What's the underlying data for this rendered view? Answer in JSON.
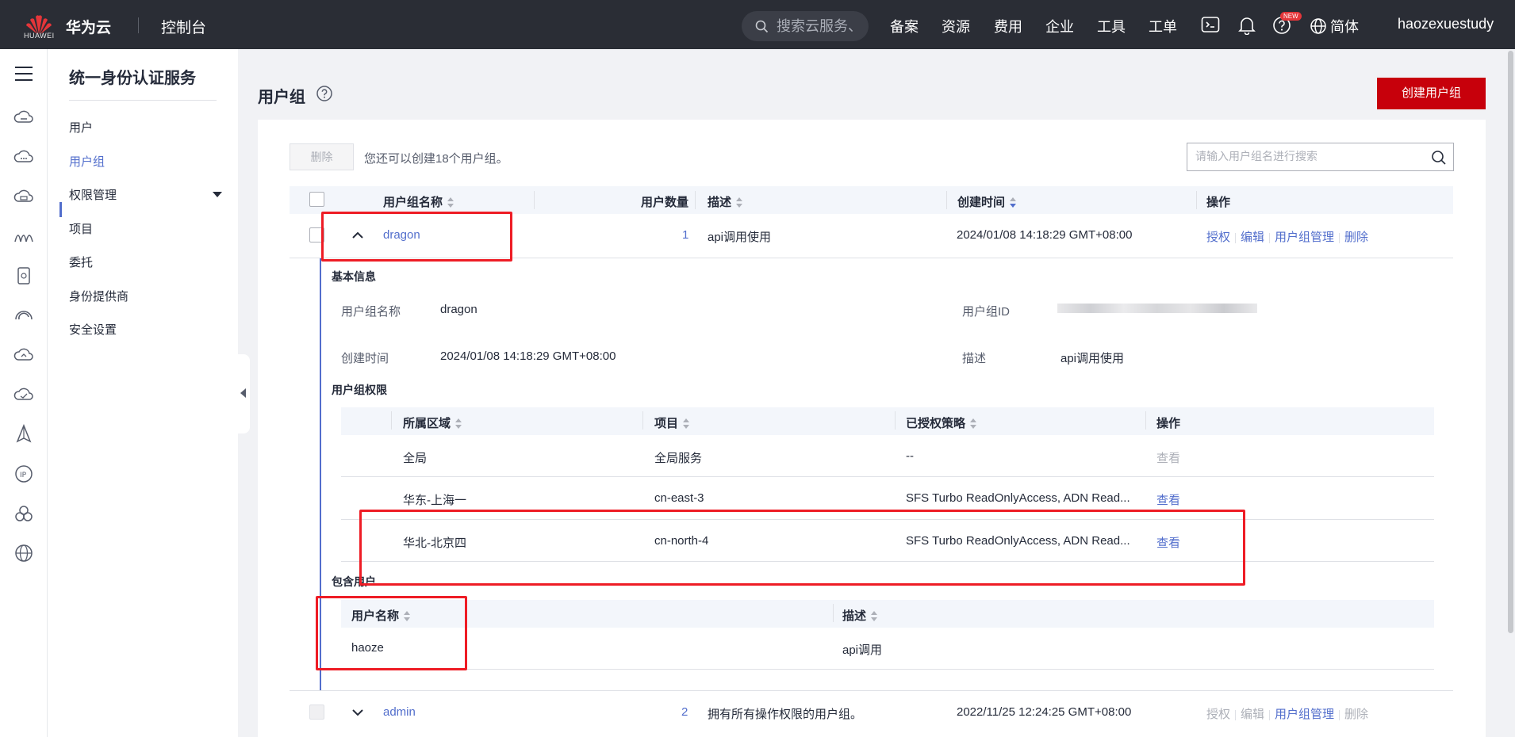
{
  "topbar": {
    "logo_text": "HUAWEI",
    "brand": "华为云",
    "console": "控制台",
    "search_placeholder": "搜索云服务、",
    "nav": [
      "备案",
      "资源",
      "费用",
      "企业",
      "工具",
      "工单"
    ],
    "new_badge": "NEW",
    "lang": "简体",
    "user": "haozexuestudy"
  },
  "rail_icons": [
    "cloud-server-icon",
    "cloud-icon",
    "storage-icon",
    "analytics-icon",
    "container-icon",
    "network-icon",
    "upload-cloud-icon",
    "monitor-cloud-icon",
    "ai-icon",
    "ip-icon",
    "cluster-icon",
    "global-icon"
  ],
  "sidemenu": {
    "title": "统一身份认证服务",
    "items": [
      "用户",
      "用户组",
      "权限管理",
      "项目",
      "委托",
      "身份提供商",
      "安全设置"
    ]
  },
  "page": {
    "title": "用户组",
    "create_button": "创建用户组",
    "delete_button": "删除",
    "quota_text": "您还可以创建18个用户组。",
    "search_placeholder": "请输入用户组名进行搜索"
  },
  "table": {
    "columns": [
      "用户组名称",
      "用户数量",
      "描述",
      "创建时间",
      "操作"
    ],
    "rows": [
      {
        "name": "dragon",
        "count": "1",
        "desc": "api调用使用",
        "created": "2024/01/08 14:18:29 GMT+08:00",
        "ops": [
          "授权",
          "编辑",
          "用户组管理",
          "删除"
        ]
      },
      {
        "name": "admin",
        "count": "2",
        "desc": "拥有所有操作权限的用户组。",
        "created": "2022/11/25 12:24:25 GMT+08:00",
        "ops": [
          "授权",
          "编辑",
          "用户组管理",
          "删除"
        ]
      }
    ]
  },
  "detail": {
    "basic_title": "基本信息",
    "name_label": "用户组名称",
    "name_value": "dragon",
    "id_label": "用户组ID",
    "created_label": "创建时间",
    "created_value": "2024/01/08 14:18:29 GMT+08:00",
    "desc_label": "描述",
    "desc_value": "api调用使用",
    "perm_title": "用户组权限",
    "perm_columns": [
      "所属区域",
      "项目",
      "已授权策略",
      "操作"
    ],
    "perm_rows": [
      {
        "region": "全局",
        "project": "全局服务",
        "policy": "--",
        "op": "查看"
      },
      {
        "region": "华东-上海一",
        "project": "cn-east-3",
        "policy": "SFS Turbo ReadOnlyAccess, ADN Read...",
        "op": "查看"
      },
      {
        "region": "华北-北京四",
        "project": "cn-north-4",
        "policy": "SFS Turbo ReadOnlyAccess, ADN Read...",
        "op": "查看"
      }
    ],
    "users_title": "包含用户",
    "user_columns": [
      "用户名称",
      "描述"
    ],
    "user_rows": [
      {
        "name": "haoze",
        "desc": "api调用"
      }
    ]
  },
  "colors": {
    "topbar": "#2a2d35",
    "brand_red": "#c7000b",
    "link": "#526ecc",
    "highlight": "#ee1c25"
  }
}
